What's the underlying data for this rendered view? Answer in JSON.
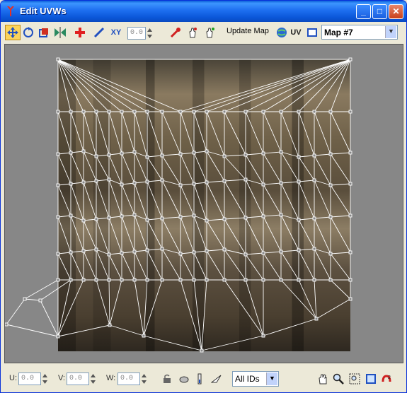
{
  "window": {
    "title": "Edit UVWs",
    "controls": {
      "minimize": "_",
      "maximize": "□",
      "close": "✕"
    }
  },
  "toolbar": {
    "spinner_value": "0.0",
    "update_map_label": "Update Map",
    "uv_label": "UV",
    "xy_label": "XY",
    "map_select": "Map #7",
    "tools": [
      "move-tool",
      "rotate-tool",
      "scale-tool",
      "mirror-tool",
      "freeform-tool",
      "paint-tool",
      "xy-tool",
      "eyedropper-tool",
      "pick-tool",
      "pick-tool-2",
      "update-map",
      "globe-tool",
      "uv-tool",
      "square-tool"
    ]
  },
  "status": {
    "u_label": "U:",
    "u_value": "0.0",
    "v_label": "V:",
    "v_value": "0.0",
    "w_label": "W:",
    "w_value": "0.0",
    "ids_select": "All IDs"
  },
  "colors": {
    "selected_tool": "#fbd35a",
    "viewport_bg": "#878787",
    "mesh_line": "#ffffff",
    "titlebar": "#1e6ff0"
  }
}
